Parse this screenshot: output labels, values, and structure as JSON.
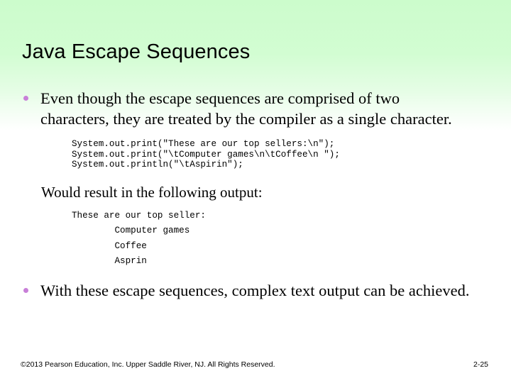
{
  "slide": {
    "title": "Java Escape Sequences",
    "bullets": [
      {
        "marker": "bullet-dot",
        "text": "Even though the escape sequences are comprised of two characters, they are treated by the compiler as a single character."
      },
      {
        "marker": "bullet-dot",
        "text": "With these escape sequences, complex text output can be achieved."
      }
    ],
    "code_block": "System.out.print(\"These are our top sellers:\\n\");\nSystem.out.print(\"\\tComputer games\\n\\tCoffee\\n \");\nSystem.out.println(\"\\tAspirin\");",
    "result_caption": "Would result in the following output:",
    "output_block": "These are our top seller:\n        Computer games\n        Coffee\n        Asprin"
  },
  "footer": {
    "copyright": "©2013 Pearson Education, Inc. Upper Saddle River, NJ. All Rights Reserved.",
    "page_number": "2-25"
  },
  "colors": {
    "background_top": "#ccfccc",
    "background_bottom": "#ffffff",
    "bullet_marker": "#c87fd8",
    "text": "#000000"
  }
}
